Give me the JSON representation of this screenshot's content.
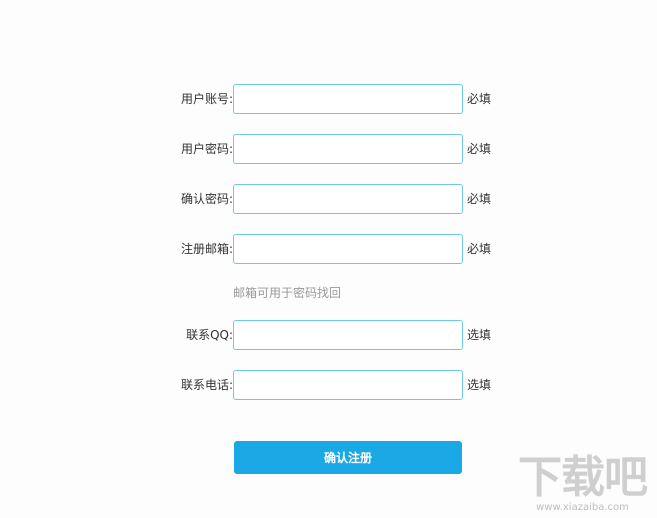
{
  "form": {
    "fields": [
      {
        "label": "用户账号:",
        "value": "",
        "note": "必填"
      },
      {
        "label": "用户密码:",
        "value": "",
        "note": "必填"
      },
      {
        "label": "确认密码:",
        "value": "",
        "note": "必填"
      },
      {
        "label": "注册邮箱:",
        "value": "",
        "note": "必填"
      },
      {
        "label": "联系QQ:",
        "value": "",
        "note": "选填"
      },
      {
        "label": "联系电话:",
        "value": "",
        "note": "选填"
      }
    ],
    "email_hint": "邮箱可用于密码找回",
    "submit_label": "确认注册"
  },
  "watermark": {
    "main": "下载吧",
    "sub": "www.xiazaiba.com"
  },
  "colors": {
    "accent": "#1ba9e6",
    "input_border": "#6cc7ea",
    "hint": "#999999"
  }
}
